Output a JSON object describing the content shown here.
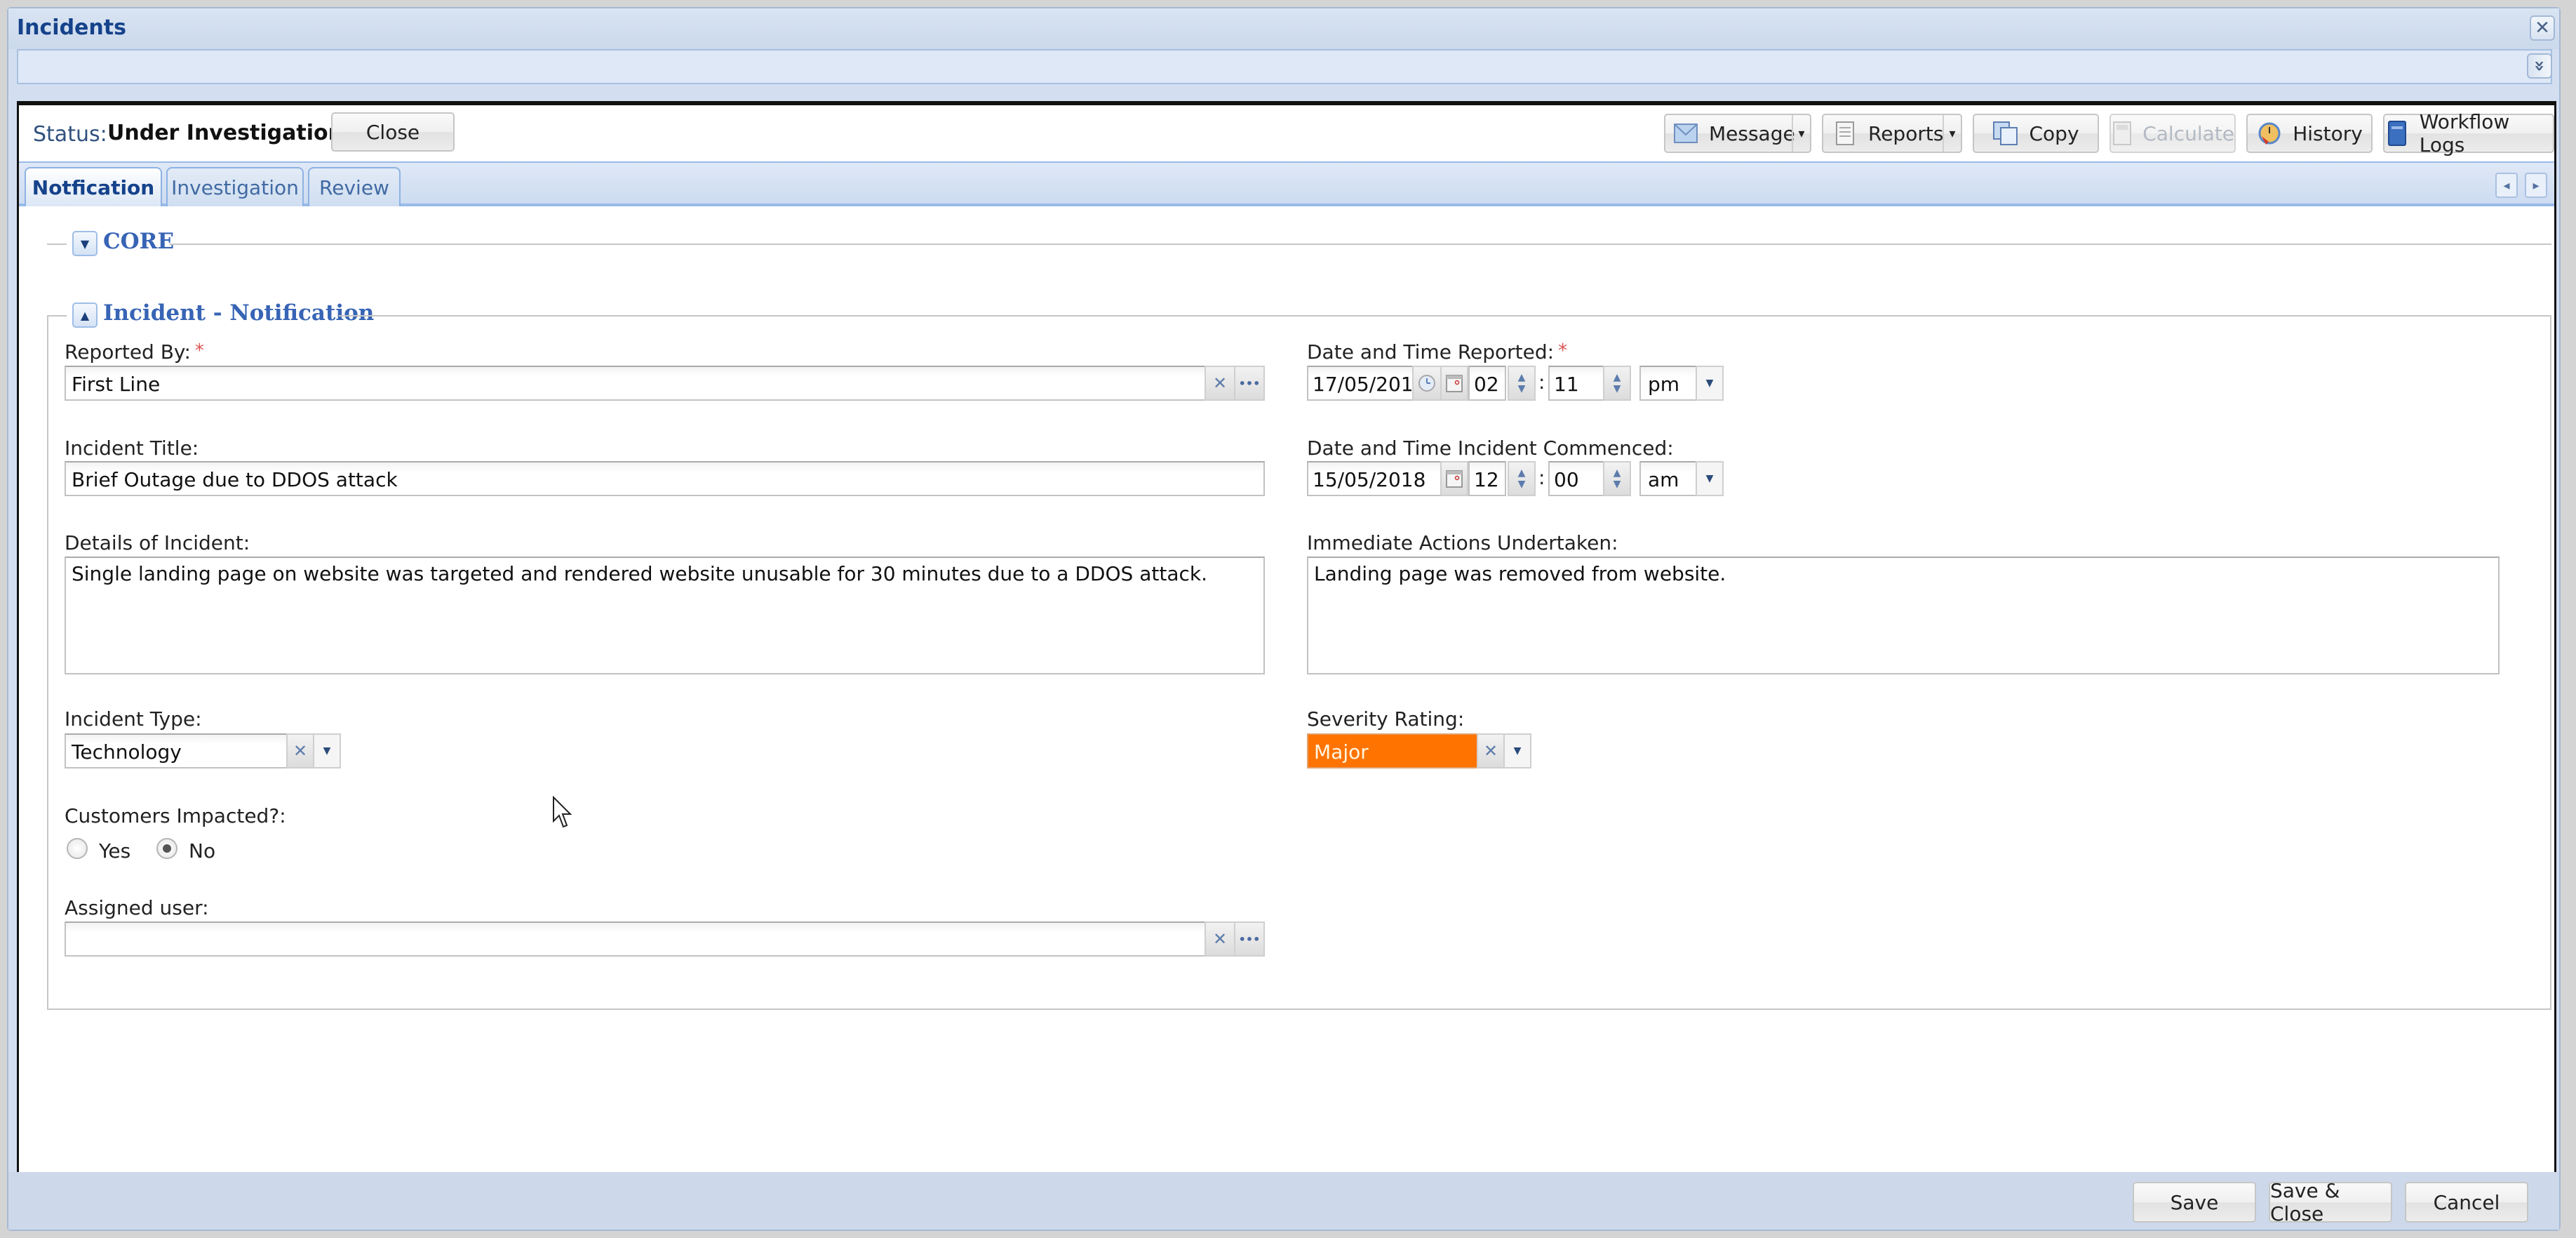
{
  "window": {
    "title": "Incidents",
    "close_icon": "close-icon",
    "expand_icon": "double-chevron-down-icon"
  },
  "status_bar": {
    "status_label": "Status:",
    "status_value": "Under Investigation",
    "close_button": "Close"
  },
  "toolbar": {
    "buttons": [
      {
        "label": "Message",
        "icon": "envelope-icon",
        "has_menu": true,
        "enabled": true
      },
      {
        "label": "Reports",
        "icon": "document-icon",
        "has_menu": true,
        "enabled": true
      },
      {
        "label": "Copy",
        "icon": "copy-icon",
        "has_menu": false,
        "enabled": true
      },
      {
        "label": "Calculate",
        "icon": "calculator-icon",
        "has_menu": false,
        "enabled": false
      },
      {
        "label": "History",
        "icon": "history-icon",
        "has_menu": false,
        "enabled": true
      },
      {
        "label": "Workflow Logs",
        "icon": "book-icon",
        "has_menu": false,
        "enabled": true
      }
    ]
  },
  "tabs": [
    {
      "label": "Notfication",
      "active": true
    },
    {
      "label": "Investigation",
      "active": false
    },
    {
      "label": "Review",
      "active": false
    }
  ],
  "sections": {
    "core": {
      "title": "CORE",
      "collapsed": true
    },
    "notification": {
      "title": "Incident - Notification",
      "collapsed": false
    }
  },
  "form": {
    "reported_by": {
      "label": "Reported By:",
      "required_mark": "*",
      "value": "First Line"
    },
    "incident_title": {
      "label": "Incident Title:",
      "value": "Brief Outage due to DDOS attack"
    },
    "details": {
      "label": "Details of Incident:",
      "value": "Single landing page on website was targeted and rendered website unusable for 30 minutes due to a DDOS attack."
    },
    "incident_type": {
      "label": "Incident Type:",
      "value": "Technology"
    },
    "customers_impacted": {
      "label": "Customers Impacted?:",
      "options": [
        "Yes",
        "No"
      ],
      "selected": "No"
    },
    "assigned_user": {
      "label": "Assigned user:",
      "value": ""
    },
    "date_reported": {
      "label": "Date and Time Reported:",
      "required_mark": "*",
      "date": "17/05/201",
      "hour": "02",
      "minute": "11",
      "ampm": "pm"
    },
    "date_commenced": {
      "label": "Date and Time Incident Commenced:",
      "date": "15/05/2018",
      "hour": "12",
      "minute": "00",
      "ampm": "am"
    },
    "immediate_actions": {
      "label": "Immediate Actions Undertaken:",
      "value": "Landing page was removed from website."
    },
    "severity": {
      "label": "Severity Rating:",
      "value": "Major",
      "color": "#ff7300"
    }
  },
  "symbols": {
    "clear": "✕",
    "ellipsis": "•••",
    "chevron_down": "⌄",
    "colon": ":",
    "dropdown_caret": "▾",
    "tab_left": "◂",
    "tab_right": "▸",
    "collapse_down": "▼",
    "collapse_up": "▲",
    "close_x": "✕",
    "double_chevron": "»"
  },
  "footer": {
    "save": "Save",
    "save_close": "Save & Close",
    "cancel": "Cancel"
  }
}
